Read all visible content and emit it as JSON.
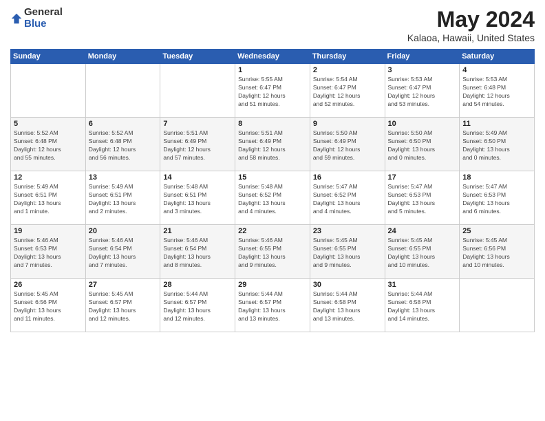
{
  "logo": {
    "general": "General",
    "blue": "Blue"
  },
  "header": {
    "title": "May 2024",
    "location": "Kalaoa, Hawaii, United States"
  },
  "days_of_week": [
    "Sunday",
    "Monday",
    "Tuesday",
    "Wednesday",
    "Thursday",
    "Friday",
    "Saturday"
  ],
  "weeks": [
    [
      {
        "day": "",
        "info": ""
      },
      {
        "day": "",
        "info": ""
      },
      {
        "day": "",
        "info": ""
      },
      {
        "day": "1",
        "info": "Sunrise: 5:55 AM\nSunset: 6:47 PM\nDaylight: 12 hours\nand 51 minutes."
      },
      {
        "day": "2",
        "info": "Sunrise: 5:54 AM\nSunset: 6:47 PM\nDaylight: 12 hours\nand 52 minutes."
      },
      {
        "day": "3",
        "info": "Sunrise: 5:53 AM\nSunset: 6:47 PM\nDaylight: 12 hours\nand 53 minutes."
      },
      {
        "day": "4",
        "info": "Sunrise: 5:53 AM\nSunset: 6:48 PM\nDaylight: 12 hours\nand 54 minutes."
      }
    ],
    [
      {
        "day": "5",
        "info": "Sunrise: 5:52 AM\nSunset: 6:48 PM\nDaylight: 12 hours\nand 55 minutes."
      },
      {
        "day": "6",
        "info": "Sunrise: 5:52 AM\nSunset: 6:48 PM\nDaylight: 12 hours\nand 56 minutes."
      },
      {
        "day": "7",
        "info": "Sunrise: 5:51 AM\nSunset: 6:49 PM\nDaylight: 12 hours\nand 57 minutes."
      },
      {
        "day": "8",
        "info": "Sunrise: 5:51 AM\nSunset: 6:49 PM\nDaylight: 12 hours\nand 58 minutes."
      },
      {
        "day": "9",
        "info": "Sunrise: 5:50 AM\nSunset: 6:49 PM\nDaylight: 12 hours\nand 59 minutes."
      },
      {
        "day": "10",
        "info": "Sunrise: 5:50 AM\nSunset: 6:50 PM\nDaylight: 13 hours\nand 0 minutes."
      },
      {
        "day": "11",
        "info": "Sunrise: 5:49 AM\nSunset: 6:50 PM\nDaylight: 13 hours\nand 0 minutes."
      }
    ],
    [
      {
        "day": "12",
        "info": "Sunrise: 5:49 AM\nSunset: 6:51 PM\nDaylight: 13 hours\nand 1 minute."
      },
      {
        "day": "13",
        "info": "Sunrise: 5:49 AM\nSunset: 6:51 PM\nDaylight: 13 hours\nand 2 minutes."
      },
      {
        "day": "14",
        "info": "Sunrise: 5:48 AM\nSunset: 6:51 PM\nDaylight: 13 hours\nand 3 minutes."
      },
      {
        "day": "15",
        "info": "Sunrise: 5:48 AM\nSunset: 6:52 PM\nDaylight: 13 hours\nand 4 minutes."
      },
      {
        "day": "16",
        "info": "Sunrise: 5:47 AM\nSunset: 6:52 PM\nDaylight: 13 hours\nand 4 minutes."
      },
      {
        "day": "17",
        "info": "Sunrise: 5:47 AM\nSunset: 6:53 PM\nDaylight: 13 hours\nand 5 minutes."
      },
      {
        "day": "18",
        "info": "Sunrise: 5:47 AM\nSunset: 6:53 PM\nDaylight: 13 hours\nand 6 minutes."
      }
    ],
    [
      {
        "day": "19",
        "info": "Sunrise: 5:46 AM\nSunset: 6:53 PM\nDaylight: 13 hours\nand 7 minutes."
      },
      {
        "day": "20",
        "info": "Sunrise: 5:46 AM\nSunset: 6:54 PM\nDaylight: 13 hours\nand 7 minutes."
      },
      {
        "day": "21",
        "info": "Sunrise: 5:46 AM\nSunset: 6:54 PM\nDaylight: 13 hours\nand 8 minutes."
      },
      {
        "day": "22",
        "info": "Sunrise: 5:46 AM\nSunset: 6:55 PM\nDaylight: 13 hours\nand 9 minutes."
      },
      {
        "day": "23",
        "info": "Sunrise: 5:45 AM\nSunset: 6:55 PM\nDaylight: 13 hours\nand 9 minutes."
      },
      {
        "day": "24",
        "info": "Sunrise: 5:45 AM\nSunset: 6:55 PM\nDaylight: 13 hours\nand 10 minutes."
      },
      {
        "day": "25",
        "info": "Sunrise: 5:45 AM\nSunset: 6:56 PM\nDaylight: 13 hours\nand 10 minutes."
      }
    ],
    [
      {
        "day": "26",
        "info": "Sunrise: 5:45 AM\nSunset: 6:56 PM\nDaylight: 13 hours\nand 11 minutes."
      },
      {
        "day": "27",
        "info": "Sunrise: 5:45 AM\nSunset: 6:57 PM\nDaylight: 13 hours\nand 12 minutes."
      },
      {
        "day": "28",
        "info": "Sunrise: 5:44 AM\nSunset: 6:57 PM\nDaylight: 13 hours\nand 12 minutes."
      },
      {
        "day": "29",
        "info": "Sunrise: 5:44 AM\nSunset: 6:57 PM\nDaylight: 13 hours\nand 13 minutes."
      },
      {
        "day": "30",
        "info": "Sunrise: 5:44 AM\nSunset: 6:58 PM\nDaylight: 13 hours\nand 13 minutes."
      },
      {
        "day": "31",
        "info": "Sunrise: 5:44 AM\nSunset: 6:58 PM\nDaylight: 13 hours\nand 14 minutes."
      },
      {
        "day": "",
        "info": ""
      }
    ]
  ]
}
